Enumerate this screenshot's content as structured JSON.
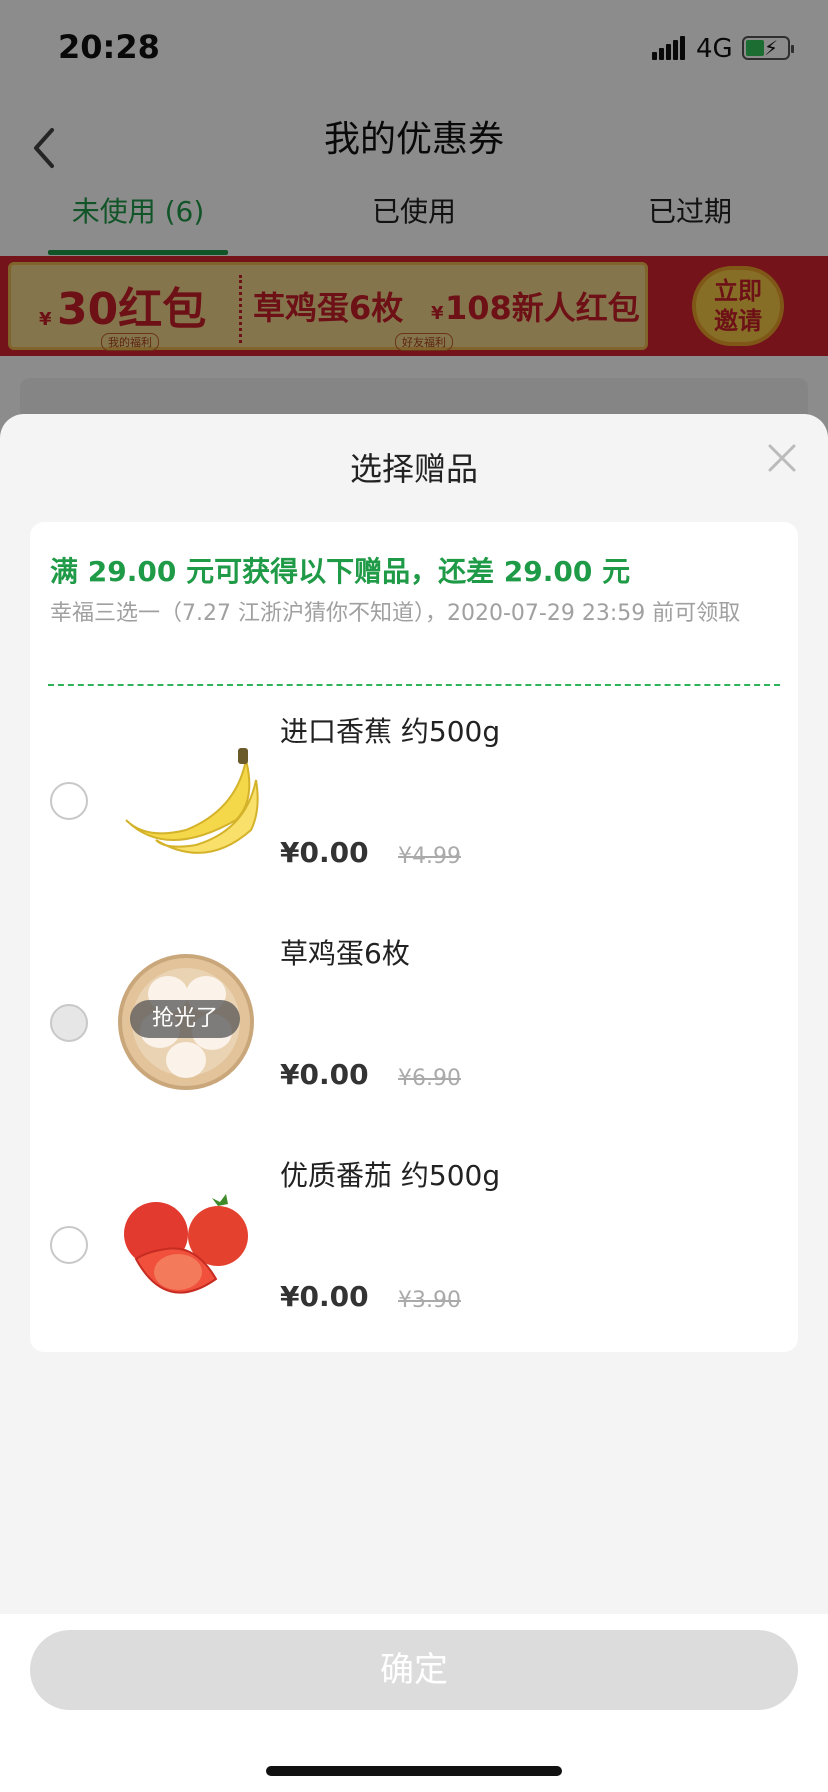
{
  "status": {
    "time": "20:28",
    "network": "4G"
  },
  "nav": {
    "title": "我的优惠券"
  },
  "tabs": [
    {
      "label": "未使用 (6)",
      "active": true
    },
    {
      "label": "已使用",
      "active": false
    },
    {
      "label": "已过期",
      "active": false
    }
  ],
  "banner": {
    "seg1_currency": "¥",
    "seg1_value": "30红包",
    "seg1_sub": "我的福利",
    "seg2_text": "草鸡蛋6枚",
    "seg2_sub": "好友福利",
    "seg3_currency": "¥",
    "seg3_text": "108新人红包",
    "invite_line1": "立即",
    "invite_line2": "邀请"
  },
  "sheet": {
    "title": "选择赠品",
    "headline": "满 29.00 元可获得以下赠品，还差 29.00 元",
    "desc": "幸福三选一（7.27 江浙沪猜你不知道），2020-07-29 23:59 前可领取",
    "items": [
      {
        "name": "进口香蕉 约500g",
        "price": "¥0.00",
        "original": "¥4.99",
        "soldout": false
      },
      {
        "name": "草鸡蛋6枚",
        "price": "¥0.00",
        "original": "¥6.90",
        "soldout": true,
        "soldout_label": "抢光了"
      },
      {
        "name": "优质番茄 约500g",
        "price": "¥0.00",
        "original": "¥3.90",
        "soldout": false
      }
    ],
    "confirm_label": "确定"
  },
  "colors": {
    "accent": "#1f9a47",
    "banner_red": "#d3242e",
    "banner_gold": "#f3d58a"
  }
}
